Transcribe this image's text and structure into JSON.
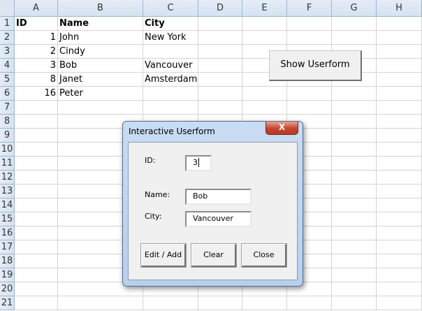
{
  "columns": [
    "A",
    "B",
    "C",
    "D",
    "E",
    "F",
    "G",
    "H"
  ],
  "rows": [
    "1",
    "2",
    "3",
    "4",
    "5",
    "6",
    "7",
    "8",
    "9",
    "10",
    "11",
    "12",
    "13",
    "14",
    "15",
    "16",
    "17",
    "18",
    "19",
    "20",
    "21"
  ],
  "cells": {
    "header": {
      "id": "ID",
      "name": "Name",
      "city": "City"
    },
    "data": [
      {
        "id": "1",
        "name": "John",
        "city": "New York"
      },
      {
        "id": "2",
        "name": "Cindy",
        "city": ""
      },
      {
        "id": "3",
        "name": "Bob",
        "city": "Vancouver"
      },
      {
        "id": "8",
        "name": "Janet",
        "city": "Amsterdam"
      },
      {
        "id": "16",
        "name": "Peter",
        "city": ""
      }
    ]
  },
  "show_button": "Show Userform",
  "dialog": {
    "title": "Interactive Userform",
    "close_glyph": "X",
    "id_label": "ID:",
    "id_value": "3",
    "name_label": "Name:",
    "name_value": "Bob",
    "city_label": "City:",
    "city_value": "Vancouver",
    "buttons": {
      "edit": "Edit / Add",
      "clear": "Clear",
      "close": "Close"
    }
  }
}
